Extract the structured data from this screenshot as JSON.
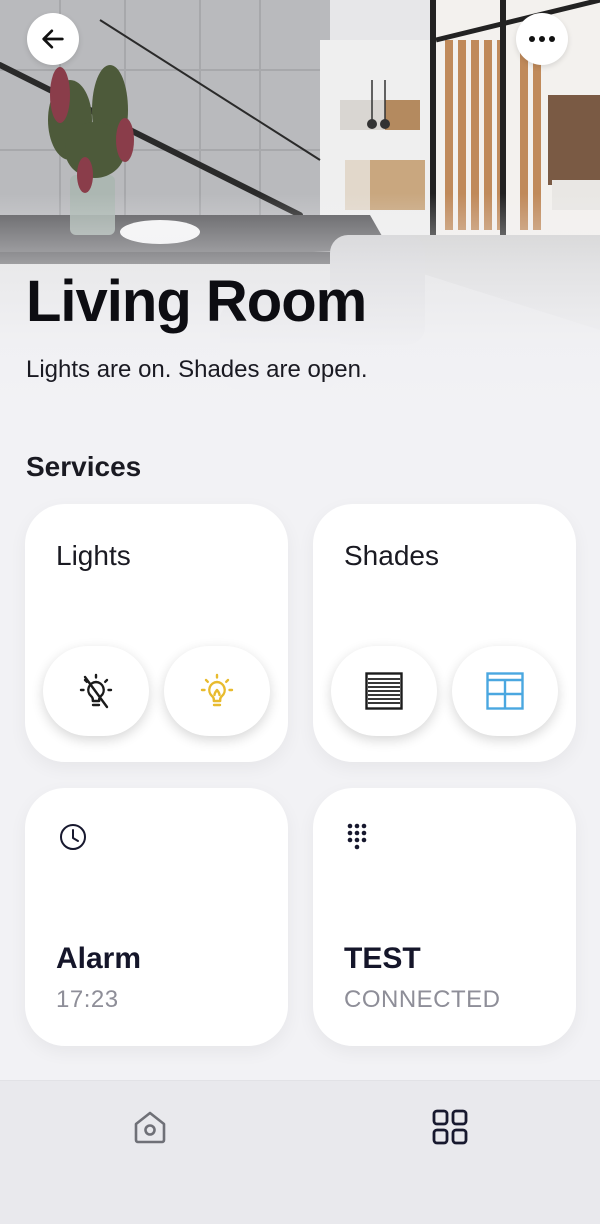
{
  "header": {
    "back_icon": "arrow-left-icon",
    "more_icon": "more-horizontal-icon"
  },
  "room": {
    "title": "Living Room",
    "status": "Lights are on. Shades are open."
  },
  "services": {
    "section_title": "Services",
    "lights": {
      "title": "Lights",
      "off_icon": "bulb-off-icon",
      "on_icon": "bulb-on-icon",
      "on_color": "#e8bb2e"
    },
    "shades": {
      "title": "Shades",
      "closed_icon": "shades-closed-icon",
      "open_icon": "shades-open-icon",
      "open_color": "#4aa7e0"
    },
    "alarm": {
      "icon": "clock-icon",
      "title": "Alarm",
      "value": "17:23"
    },
    "test": {
      "icon": "keypad-icon",
      "title": "TEST",
      "value": "CONNECTED"
    }
  },
  "bottom_nav": {
    "items": [
      {
        "icon": "home-icon"
      },
      {
        "icon": "grid-icon"
      }
    ]
  },
  "colors": {
    "background": "#f2f2f5",
    "card": "#ffffff",
    "text_primary": "#16161c",
    "text_secondary": "#8e8e98",
    "nav_background": "#e9e9ed"
  }
}
